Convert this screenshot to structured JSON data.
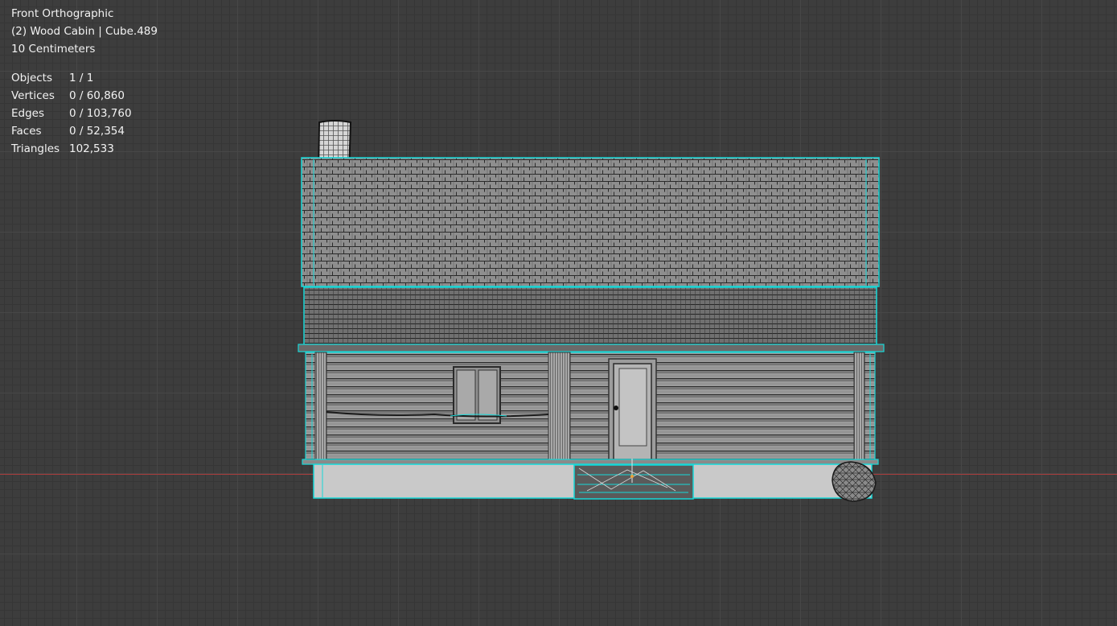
{
  "viewport": {
    "view_name": "Front Orthographic",
    "object_info": "(2) Wood Cabin | Cube.489",
    "scale": "10 Centimeters"
  },
  "stats": [
    {
      "label": "Objects",
      "value": "1 / 1"
    },
    {
      "label": "Vertices",
      "value": "0 / 60,860"
    },
    {
      "label": "Edges",
      "value": "0 / 103,760"
    },
    {
      "label": "Faces",
      "value": "0 / 52,354"
    },
    {
      "label": "Triangles",
      "value": "102,533"
    }
  ],
  "colors": {
    "background": "#3d3d3d",
    "selection_outline": "#17d8d8",
    "x_axis": "#a93d3d"
  }
}
